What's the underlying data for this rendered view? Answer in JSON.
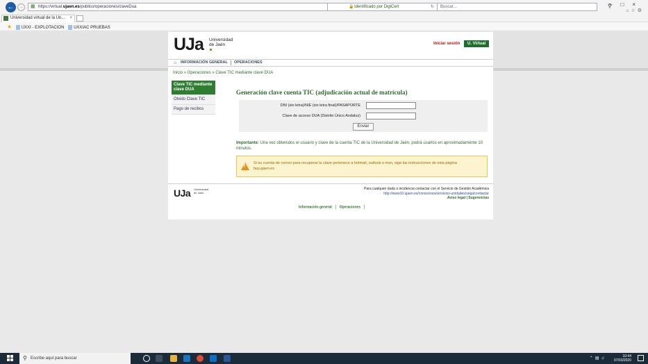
{
  "browser": {
    "url_prefix": "https://virtual.",
    "url_domain": "ujaen.es",
    "url_suffix": "/publico/operaciones/claveDua",
    "cert_label": "Identificado por DigiCert",
    "search_placeholder": "Buscar...",
    "tab_title": "Universidad virtual de la Un...",
    "favorites": [
      "UXXI - EXPLOTACION",
      "UXXIAC PRUEBAS"
    ]
  },
  "header": {
    "logo": "UJa",
    "logo_line1": "Universidad",
    "logo_line2": "de Jaén",
    "login_button": "Iniciar sesión",
    "virtual_button": "U. Virtual"
  },
  "nav": {
    "items": [
      "INFORMACIÓN GENERAL",
      "OPERACIONES"
    ]
  },
  "breadcrumb": "Inicio » Operaciones » Clave TIC mediante clave DUA",
  "sidebar": {
    "items": [
      "Clave TIC mediante clave DUA",
      "Olvido Clave TIC",
      "Pago de recibos"
    ]
  },
  "main": {
    "title": "Generación clave cuenta TIC (adjudicación actual de matrícula)",
    "field1_label": "DNI (sin letra)/NIE (sin letra final)/PASAPORTE",
    "field2_label": "Clave de acceso DUA (Distrito Único Andaluz)",
    "submit_label": "Enviar",
    "important_label": "Importante:",
    "important_text": " Una vez obtenidos el usuario y clave de la cuenta TIC de la Universidad de Jaén, podrá usarlos en aproximadamente 10 minutos.",
    "warning_line1": "Si su cuenta de correo para recuperar la clave pertenece a hotmail, outlook o msn, siga las instrucciones de esta página",
    "warning_line2": "faq.ujaen.es"
  },
  "footer": {
    "logo": "UJa",
    "logo_line1": "Universidad",
    "logo_line2": "de Jaén",
    "contact_text": "Para cualquier duda o incidencia contactar con el Servicio de Gestión Académica",
    "contact_link": "http://www10.ujaen.es/conocenos/servicios-unidades/sega/contactar",
    "legal": "Aviso legal | Sugerencias",
    "links": [
      "Información general",
      "Operaciones"
    ]
  },
  "taskbar": {
    "search_placeholder": "Escribe aquí para buscar",
    "time": "10:44",
    "date": "07/03/2020"
  },
  "colors": {
    "accent_green": "#2e7d32",
    "title_green": "#2f6b2f",
    "warning_bg": "#fbf4cf",
    "taskbar": "#1b2b3a"
  }
}
